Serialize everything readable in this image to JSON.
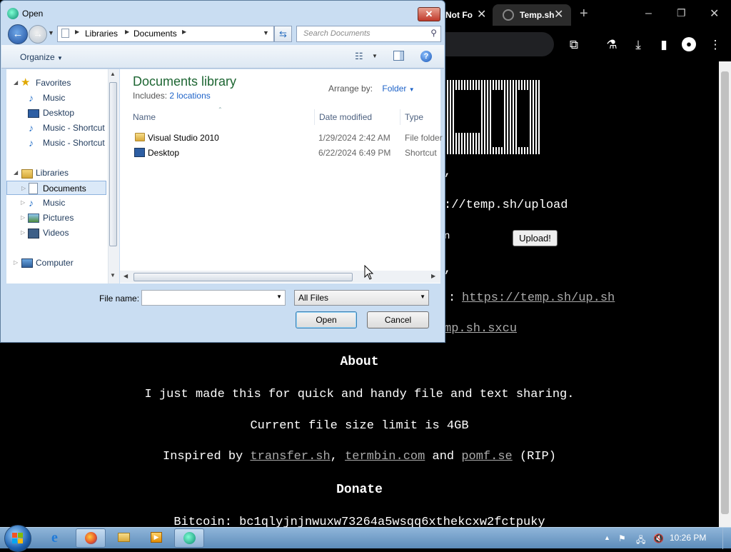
{
  "browser": {
    "tabs": [
      {
        "label": "Not Fo",
        "close": "✕"
      },
      {
        "label": "Temp.sh",
        "close": "✕"
      }
    ],
    "new_tab": "+",
    "window_controls": [
      "–",
      "❐",
      "✕"
    ],
    "page": {
      "upload_url_text": "://temp.sh/upload",
      "partial_text_1": "n",
      "upload_button": "Upload!",
      "script_link_prefix": ":",
      "script_link": "https://temp.sh/up.sh",
      "sxcu_link": "mp.sh.sxcu",
      "about_heading": "About",
      "about_text": "I just made this for quick and handy file and text sharing.",
      "limit_text": "Current file size limit is 4GB",
      "inspired_prefix": "Inspired by",
      "inspired_links": [
        "transfer.sh",
        "termbin.com",
        "pomf.se"
      ],
      "inspired_sep": ",",
      "inspired_and": "and",
      "inspired_suffix": "(RIP)",
      "donate_heading": "Donate",
      "bitcoin_text": "Bitcoin: bc1qlyjnjnwuxw73264a5wsqq6xthekcxw2fctpuky"
    }
  },
  "dialog": {
    "title": "Open",
    "close_label": "✕",
    "breadcrumb": [
      "Libraries",
      "Documents"
    ],
    "search_placeholder": "Search Documents",
    "organize_label": "Organize",
    "nav": {
      "favorites": "Favorites",
      "fav_items": [
        "Music",
        "Desktop",
        "Music - Shortcut",
        "Music - Shortcut"
      ],
      "libraries": "Libraries",
      "lib_items": [
        "Documents",
        "Music",
        "Pictures",
        "Videos"
      ],
      "computer": "Computer",
      "selected": "Documents"
    },
    "library_title": "Documents library",
    "includes_label": "Includes:",
    "includes_link": "2 locations",
    "arrange_label": "Arrange by:",
    "arrange_value": "Folder",
    "columns": [
      "Name",
      "Date modified",
      "Type"
    ],
    "files": [
      {
        "name": "Visual Studio 2010",
        "date": "1/29/2024 2:42 AM",
        "type": "File folder",
        "icon": "folder-icon"
      },
      {
        "name": "Desktop",
        "date": "6/22/2024 6:49 PM",
        "type": "Shortcut",
        "icon": "desktop-shortcut-icon"
      }
    ],
    "file_name_label": "File name:",
    "file_name_value": "",
    "filter_value": "All Files",
    "open_label": "Open",
    "cancel_label": "Cancel",
    "help": "?"
  },
  "taskbar": {
    "clock": "10:26 PM",
    "pinned": [
      "ie-icon",
      "firefox-icon",
      "explorer-icon",
      "media-player-icon",
      "chrome-open-dialog-icon"
    ]
  }
}
